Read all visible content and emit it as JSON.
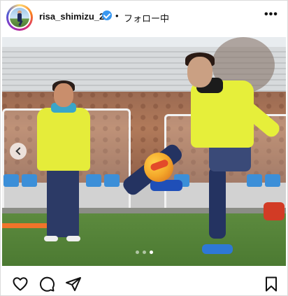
{
  "post": {
    "username": "risa_shimizu_2",
    "separator": "•",
    "follow_status": "フォロー中",
    "more_label": "•••"
  },
  "carousel": {
    "count": 3,
    "active_index": 3
  },
  "colors": {
    "verified_badge": "#3897f0",
    "icon_stroke": "#111111"
  },
  "icons": [
    "avatar",
    "verified-badge-icon",
    "more-icon",
    "previous-icon",
    "heart-icon",
    "comment-icon",
    "share-icon",
    "bookmark-icon"
  ]
}
